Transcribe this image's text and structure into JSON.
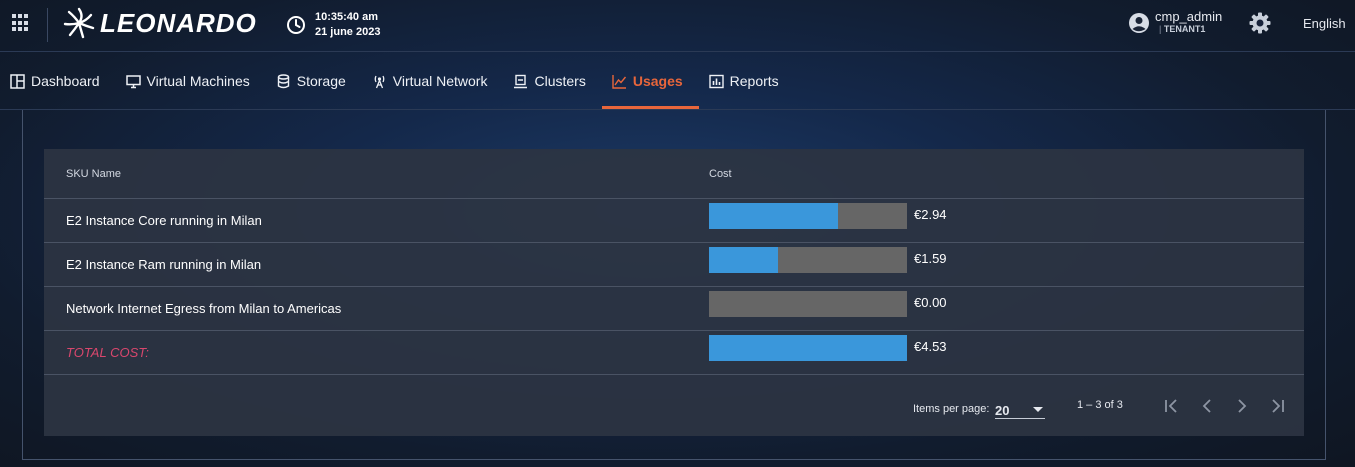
{
  "header": {
    "brand": "LEONARDO",
    "time": "10:35:40 am",
    "date": "21 june 2023",
    "user": "cmp_admin",
    "tenant": "TENANT1",
    "language": "English"
  },
  "nav": {
    "items": [
      {
        "label": "Dashboard",
        "icon": "dashboard-icon"
      },
      {
        "label": "Virtual Machines",
        "icon": "monitor-icon"
      },
      {
        "label": "Storage",
        "icon": "database-icon"
      },
      {
        "label": "Virtual Network",
        "icon": "antenna-icon"
      },
      {
        "label": "Clusters",
        "icon": "cluster-icon"
      },
      {
        "label": "Usages",
        "icon": "chart-line-icon",
        "active": true
      },
      {
        "label": "Reports",
        "icon": "report-icon"
      }
    ]
  },
  "table": {
    "headers": {
      "sku": "SKU Name",
      "cost": "Cost"
    },
    "rows": [
      {
        "sku": "E2 Instance Core running in Milan",
        "cost": "€2.94",
        "fraction": 0.65
      },
      {
        "sku": "E2 Instance Ram running in Milan",
        "cost": "€1.59",
        "fraction": 0.35
      },
      {
        "sku": "Network Internet Egress from Milan to Americas",
        "cost": "€0.00",
        "fraction": 0
      }
    ],
    "total": {
      "label": "TOTAL COST:",
      "cost": "€4.53",
      "fraction": 1
    }
  },
  "paginator": {
    "items_per_page_label": "Items per page:",
    "items_per_page": "20",
    "range": "1 – 3 of 3"
  },
  "colors": {
    "accent": "#e8663b",
    "bar_fill": "#3a97db",
    "bar_track": "#666666",
    "total_label": "#d9476d"
  }
}
